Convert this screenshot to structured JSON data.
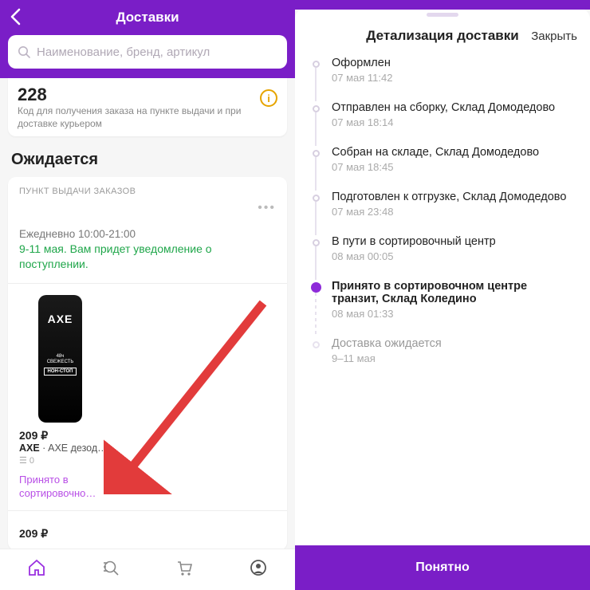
{
  "left": {
    "title": "Доставки",
    "search_placeholder": "Наименование, бренд, артикул",
    "code_number": "228",
    "code_desc": "Код для получения заказа на пункте выдачи и при доставке курьером",
    "section": "Ожидается",
    "pvz_label": "ПУНКТ ВЫДАЧИ ЗАКАЗОВ",
    "pvz_hours": "Ежедневно 10:00-21:00",
    "pvz_eta": "9-11 мая. Вам придет уведомление о поступлении.",
    "item": {
      "price": "209 ₽",
      "brand": "AXE",
      "desc": " · AXE дезод…",
      "qty": "0",
      "status_l1": "Принято в",
      "status_l2": "сортировочно…"
    },
    "total": "209 ₽"
  },
  "right": {
    "title": "Детализация доставки",
    "close": "Закрыть",
    "events": [
      {
        "title": "Оформлен",
        "sub": "07 мая 11:42",
        "dot": "past"
      },
      {
        "title": "Отправлен на сборку, Склад Домодедово",
        "sub": "07 мая 18:14",
        "dot": "past"
      },
      {
        "title": "Собран на складе, Склад Домодедово",
        "sub": "07 мая 18:45",
        "dot": "past"
      },
      {
        "title": "Подготовлен к отгрузке, Склад Домодедово",
        "sub": "07 мая 23:48",
        "dot": "past"
      },
      {
        "title": "В пути в сортировочный центр",
        "sub": "08 мая 00:05",
        "dot": "past"
      },
      {
        "title": "Принято в сортировочном центре транзит, Склад Коледино",
        "sub": "08 мая 01:33",
        "dot": "active"
      },
      {
        "title": "Доставка ожидается",
        "sub": "9–11 мая",
        "dot": "future"
      }
    ],
    "button": "Понятно"
  },
  "colors": {
    "brand": "#7a1ec7",
    "accent": "#b84ee6",
    "green": "#1fa64a",
    "warn": "#e6a400",
    "arrow": "#e23b3b"
  }
}
